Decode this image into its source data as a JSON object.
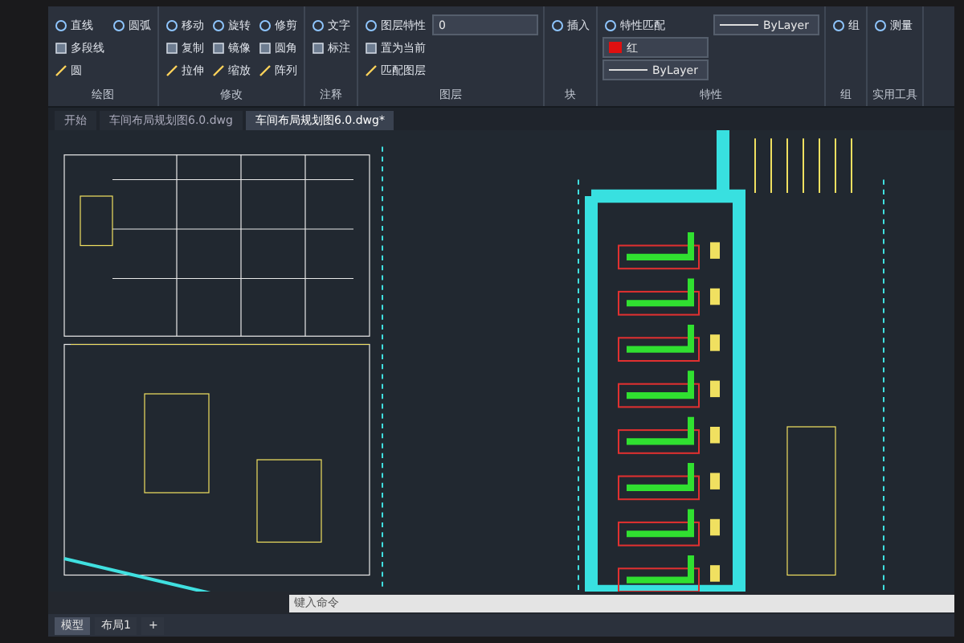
{
  "ribbon": {
    "panels": [
      {
        "title": "绘图",
        "tools": [
          "直线",
          "多段线",
          "圆",
          "圆弧"
        ]
      },
      {
        "title": "修改",
        "tools": [
          "移动",
          "复制",
          "拉伸",
          "旋转",
          "镜像",
          "缩放",
          "修剪",
          "圆角",
          "阵列"
        ]
      },
      {
        "title": "注释",
        "tools": [
          "文字",
          "标注"
        ]
      },
      {
        "title": "图层",
        "tools": [
          "图层特性",
          "置为当前",
          "匹配图层"
        ],
        "layer": "0"
      },
      {
        "title": "块",
        "tools": [
          "插入"
        ]
      },
      {
        "title": "特性",
        "tools": [
          "特性匹配"
        ],
        "color_name": "红",
        "color": "#e01010",
        "linetype": "ByLayer",
        "lineweight": "ByLayer"
      },
      {
        "title": "组",
        "tools": [
          "组"
        ]
      },
      {
        "title": "实用工具",
        "tools": [
          "测量"
        ]
      }
    ]
  },
  "file_tabs": [
    {
      "label": "开始",
      "selected": false
    },
    {
      "label": "车间布局规划图6.0.dwg",
      "selected": false
    },
    {
      "label": "车间布局规划图6.0.dwg*",
      "selected": true
    }
  ],
  "command_line": {
    "placeholder": "键入命令"
  },
  "layout_tabs": [
    {
      "label": "模型",
      "selected": true
    },
    {
      "label": "布局1",
      "selected": false
    }
  ],
  "add_layout": "+"
}
